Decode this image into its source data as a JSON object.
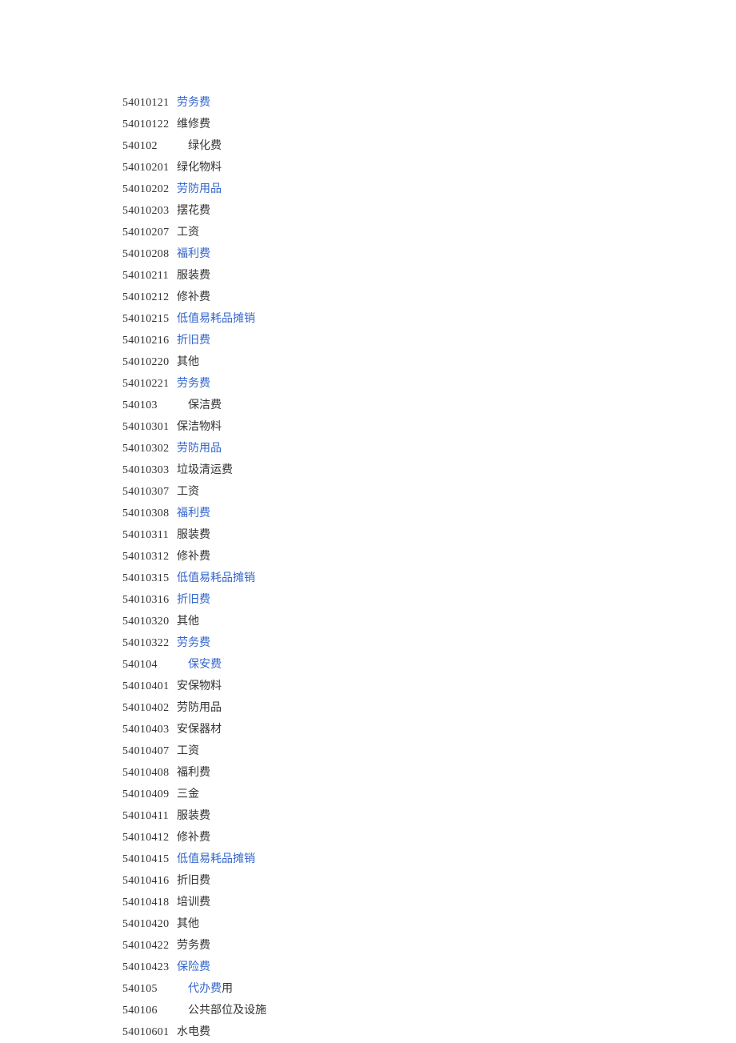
{
  "rows": [
    {
      "code": "54010121",
      "label": "劳务费",
      "link": true,
      "indent": 1,
      "mixed": false
    },
    {
      "code": "54010122",
      "label": "维修费",
      "link": false,
      "indent": 1,
      "mixed": false
    },
    {
      "code": "540102",
      "label": "绿化费",
      "link": false,
      "indent": 2,
      "mixed": false
    },
    {
      "code": "54010201",
      "label": "绿化物料",
      "link": false,
      "indent": 1,
      "mixed": false
    },
    {
      "code": "54010202",
      "label": "劳防用品",
      "link": true,
      "indent": 1,
      "mixed": false
    },
    {
      "code": "54010203",
      "label": "摆花费",
      "link": false,
      "indent": 1,
      "mixed": false
    },
    {
      "code": "54010207",
      "label": "工资",
      "link": false,
      "indent": 1,
      "mixed": false
    },
    {
      "code": "54010208",
      "label": "福利费",
      "link": true,
      "indent": 1,
      "mixed": false
    },
    {
      "code": "54010211",
      "label": "服装费",
      "link": false,
      "indent": 1,
      "mixed": false
    },
    {
      "code": "54010212",
      "label": "修补费",
      "link": false,
      "indent": 1,
      "mixed": false
    },
    {
      "code": "54010215",
      "label": "低值易耗品摊销",
      "link": true,
      "indent": 1,
      "mixed": false
    },
    {
      "code": "54010216",
      "label": "折旧费",
      "link": true,
      "indent": 1,
      "mixed": false
    },
    {
      "code": "54010220",
      "label": "其他",
      "link": false,
      "indent": 1,
      "mixed": false
    },
    {
      "code": "54010221",
      "label": "劳务费",
      "link": true,
      "indent": 1,
      "mixed": false
    },
    {
      "code": "540103",
      "label": "保洁费",
      "link": false,
      "indent": 2,
      "mixed": false
    },
    {
      "code": "54010301",
      "label": "保洁物料",
      "link": false,
      "indent": 1,
      "mixed": false
    },
    {
      "code": "54010302",
      "label": "劳防用品",
      "link": true,
      "indent": 1,
      "mixed": false
    },
    {
      "code": "54010303",
      "label": "垃圾清运费",
      "link": false,
      "indent": 1,
      "mixed": false
    },
    {
      "code": "54010307",
      "label": "工资",
      "link": false,
      "indent": 1,
      "mixed": false
    },
    {
      "code": "54010308",
      "label": "福利费",
      "link": true,
      "indent": 1,
      "mixed": false
    },
    {
      "code": "54010311",
      "label": "服装费",
      "link": false,
      "indent": 1,
      "mixed": false
    },
    {
      "code": "54010312",
      "label": "修补费",
      "link": false,
      "indent": 1,
      "mixed": false
    },
    {
      "code": "54010315",
      "label": "低值易耗品摊销",
      "link": true,
      "indent": 1,
      "mixed": false
    },
    {
      "code": "54010316",
      "label": "折旧费",
      "link": true,
      "indent": 1,
      "mixed": false
    },
    {
      "code": "54010320",
      "label": "其他",
      "link": false,
      "indent": 1,
      "mixed": false
    },
    {
      "code": "54010322",
      "label": "劳务费",
      "link": true,
      "indent": 1,
      "mixed": false
    },
    {
      "code": "540104",
      "label": "保安费",
      "link": true,
      "indent": 2,
      "mixed": false
    },
    {
      "code": "54010401",
      "label": "安保物料",
      "link": false,
      "indent": 1,
      "mixed": false
    },
    {
      "code": "54010402",
      "label": "劳防用品",
      "link": false,
      "indent": 1,
      "mixed": false
    },
    {
      "code": "54010403",
      "label": "安保器材",
      "link": false,
      "indent": 1,
      "mixed": false
    },
    {
      "code": "54010407",
      "label": "工资",
      "link": false,
      "indent": 1,
      "mixed": false
    },
    {
      "code": "54010408",
      "label": "福利费",
      "link": false,
      "indent": 1,
      "mixed": false
    },
    {
      "code": "54010409",
      "label": "三金",
      "link": false,
      "indent": 1,
      "mixed": false
    },
    {
      "code": "54010411",
      "label": "服装费",
      "link": false,
      "indent": 1,
      "mixed": false
    },
    {
      "code": "54010412",
      "label": "修补费",
      "link": false,
      "indent": 1,
      "mixed": false
    },
    {
      "code": "54010415",
      "label": "低值易耗品摊销",
      "link": true,
      "indent": 1,
      "mixed": false
    },
    {
      "code": "54010416",
      "label": "折旧费",
      "link": false,
      "indent": 1,
      "mixed": false
    },
    {
      "code": "54010418",
      "label": "培训费",
      "link": false,
      "indent": 1,
      "mixed": false
    },
    {
      "code": "54010420",
      "label": "其他",
      "link": false,
      "indent": 1,
      "mixed": false
    },
    {
      "code": "54010422",
      "label": "劳务费",
      "link": false,
      "indent": 1,
      "mixed": false
    },
    {
      "code": "54010423",
      "label": "保险费",
      "link": true,
      "indent": 1,
      "mixed": false
    },
    {
      "code": "540105",
      "label": "代办费",
      "link": true,
      "indent": 2,
      "mixed": true,
      "suffix": "用"
    },
    {
      "code": "540106",
      "label": "公共部位及设施",
      "link": false,
      "indent": 2,
      "mixed": false
    },
    {
      "code": "54010601",
      "label": "水电费",
      "link": false,
      "indent": 1,
      "mixed": false
    }
  ]
}
